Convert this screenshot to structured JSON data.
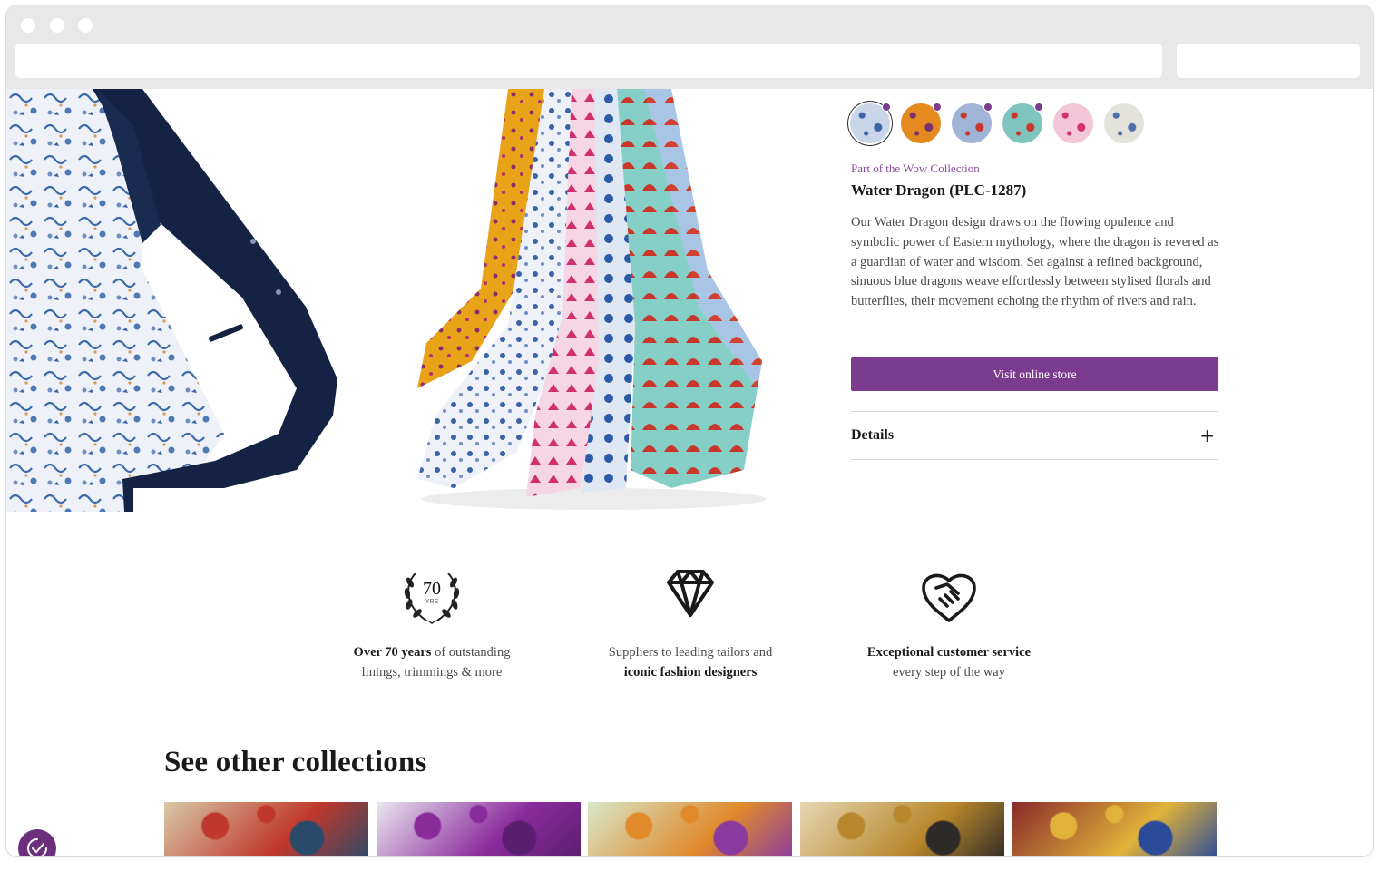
{
  "product": {
    "collection_link": "Part of the Wow Collection",
    "title": "Water Dragon (PLC-1287)",
    "description": "Our Water Dragon design draws on the flowing opulence and symbolic power of Eastern mythology, where the dragon is revered as a guardian of water and wisdom. Set against a refined background, sinuous blue dragons weave effortlessly between stylised florals and butterflies, their movement echoing the rhythm of rivers and rain.",
    "store_button": "Visit online store",
    "details_label": "Details",
    "details_icon": "plus-icon"
  },
  "swatches": [
    {
      "name": "water-dragon",
      "color": "#c9d6ea",
      "accent": "#3b63a8",
      "selected": true,
      "has_badge": true
    },
    {
      "name": "orange-pattern",
      "color": "#e58a1f",
      "accent": "#7a2f6e",
      "selected": false,
      "has_badge": true
    },
    {
      "name": "fans-blue",
      "color": "#9fb4d6",
      "accent": "#c8372b",
      "selected": false,
      "has_badge": true
    },
    {
      "name": "fans-aqua",
      "color": "#7fc4bd",
      "accent": "#c8372b",
      "selected": false,
      "has_badge": true
    },
    {
      "name": "pink-toile",
      "color": "#f3c6d8",
      "accent": "#d0306e",
      "selected": false,
      "has_badge": false
    },
    {
      "name": "blue-floral",
      "color": "#e3e3dc",
      "accent": "#4f6fa8",
      "selected": false,
      "has_badge": false
    }
  ],
  "features": [
    {
      "icon": "laurel-70-years-icon",
      "badge_number": "70",
      "badge_unit": "YRS",
      "bold": "Over 70 years",
      "text_after": " of outstanding",
      "line2": "linings, trimmings & more"
    },
    {
      "icon": "diamond-icon",
      "line1": "Suppliers to leading tailors and",
      "bold": "iconic fashion designers"
    },
    {
      "icon": "handshake-icon",
      "bold": "Exceptional customer service",
      "line2": "every step of the way"
    }
  ],
  "other_collections": {
    "title": "See other collections",
    "tiles": [
      {
        "name": "collection-horse",
        "base": "#d8c9a8",
        "c1": "#c0382b",
        "c2": "#2a4a6a"
      },
      {
        "name": "collection-purple-jungle",
        "base": "#e9e6ef",
        "c1": "#8a2b9c",
        "c2": "#5a1e6e"
      },
      {
        "name": "collection-butterflies",
        "base": "#d7e7c9",
        "c1": "#e0892b",
        "c2": "#8b3aa0"
      },
      {
        "name": "collection-safari-gold",
        "base": "#e6d7b4",
        "c1": "#b8862b",
        "c2": "#2e2a28"
      },
      {
        "name": "collection-paisley",
        "base": "#8a2a2a",
        "c1": "#e0b23a",
        "c2": "#2a4a9a"
      }
    ]
  },
  "colors": {
    "accent": "#7b3b8e",
    "link": "#8a4a9c",
    "text": "#1a1a1a",
    "muted": "#4a4a4a"
  },
  "accessibility_button_icon": "accessibility-icon"
}
